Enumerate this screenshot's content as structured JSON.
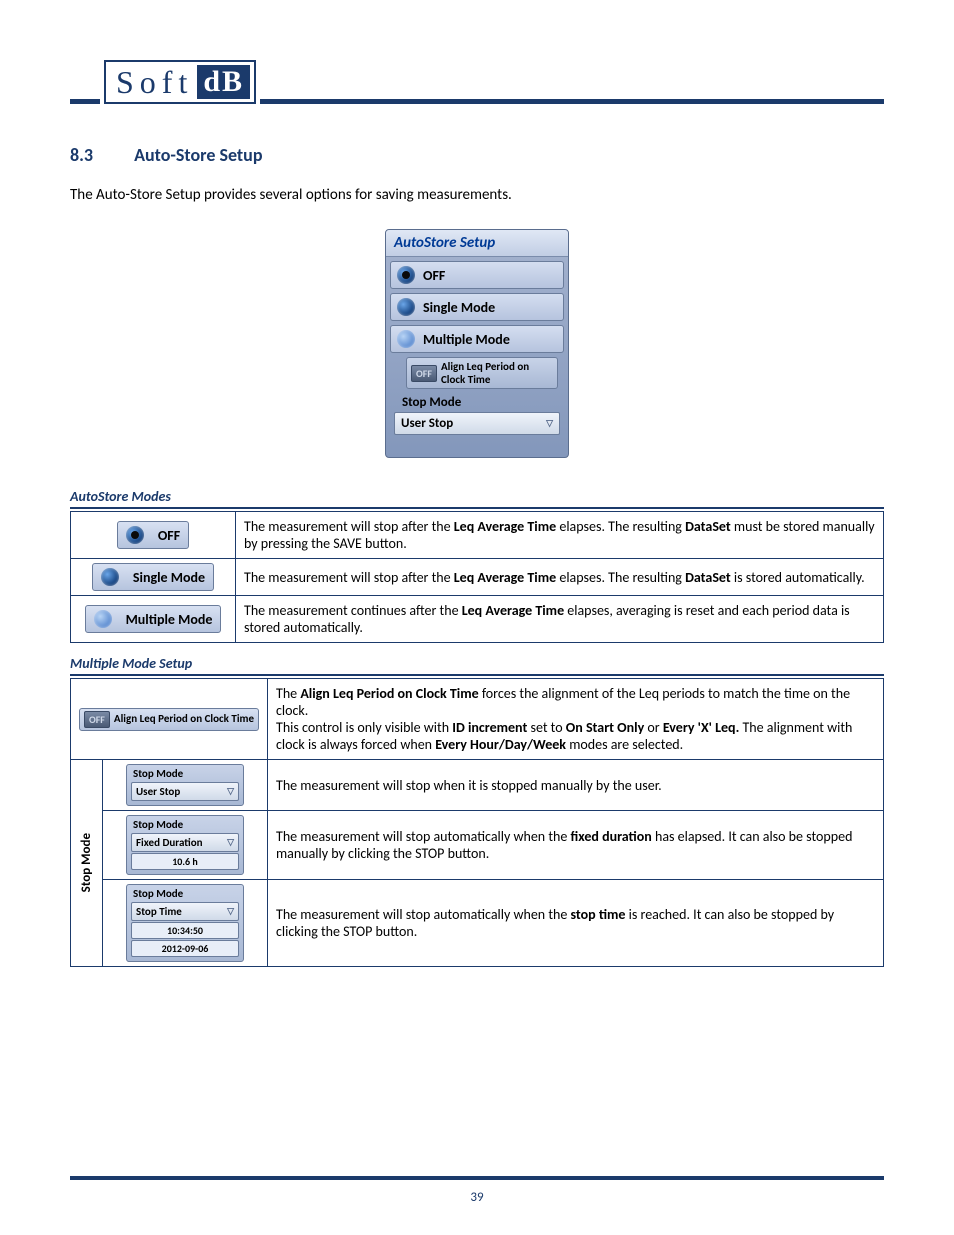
{
  "logo": {
    "soft": "Soft",
    "db": "dB"
  },
  "section": {
    "number": "8.3",
    "title": "Auto-Store Setup"
  },
  "intro": "The Auto-Store Setup provides several options for saving measurements.",
  "panel": {
    "title": "AutoStore Setup",
    "off": "OFF",
    "single": "Single Mode",
    "multiple": "Multiple Mode",
    "align_toggle": "OFF",
    "align_label": "Align Leq Period on Clock Time",
    "stop_mode_label": "Stop Mode",
    "dropdown": "User Stop"
  },
  "caption1": "AutoStore Modes",
  "modes": {
    "off": {
      "label": "OFF",
      "desc_pre": "The measurement will stop after the ",
      "desc_b1": "Leq Average Time",
      "desc_mid": " elapses. The resulting ",
      "desc_b2": "DataSet",
      "desc_post": " must be stored manually by pressing the SAVE button."
    },
    "single": {
      "label": "Single Mode",
      "desc_pre": "The measurement will stop after the ",
      "desc_b1": "Leq Average Time",
      "desc_mid": " elapses. The resulting ",
      "desc_b2": "DataSet",
      "desc_post": " is stored automatically."
    },
    "multiple": {
      "label": "Multiple Mode",
      "desc_pre": "The measurement continues after the ",
      "desc_b1": "Leq Average Time",
      "desc_post": " elapses, averaging is reset and each period data is stored automatically."
    }
  },
  "caption2": "Multiple Mode Setup",
  "mm": {
    "align": {
      "toggle": "OFF",
      "label": "Align Leq Period on Clock Time",
      "p1_a": "The ",
      "p1_b": "Align Leq Period on Clock Time",
      "p1_c": " forces the alignment of the Leq periods to match the time on the clock.",
      "p2_a": "This control is only visible with ",
      "p2_b": "ID increment",
      "p2_c": " set to ",
      "p2_d": "On Start Only",
      "p2_e": " or ",
      "p2_f": "Every 'X' Leq.",
      "p2_g": " The alignment with clock is always forced when ",
      "p2_h": "Every Hour/Day/Week",
      "p2_i": " modes are selected."
    },
    "stop_mode_vert": "Stop Mode",
    "stop_mode_t": "Stop Mode",
    "user_stop": {
      "val": "User Stop",
      "desc": "The measurement will stop when it is stopped manually by the user."
    },
    "fixed": {
      "val": "Fixed Duration",
      "sub": "10.6 h",
      "desc_a": "The measurement will stop automatically when the ",
      "desc_b": "fixed duration",
      "desc_c": " has elapsed. It can also be stopped manually by clicking the STOP button."
    },
    "stop_time": {
      "val": "Stop Time",
      "sub1": "10:34:50",
      "sub2": "2012-09-06",
      "desc_a": "The measurement will stop automatically when the ",
      "desc_b": "stop time",
      "desc_c": " is reached. It can also be stopped by clicking the STOP button."
    }
  },
  "page_number": "39"
}
